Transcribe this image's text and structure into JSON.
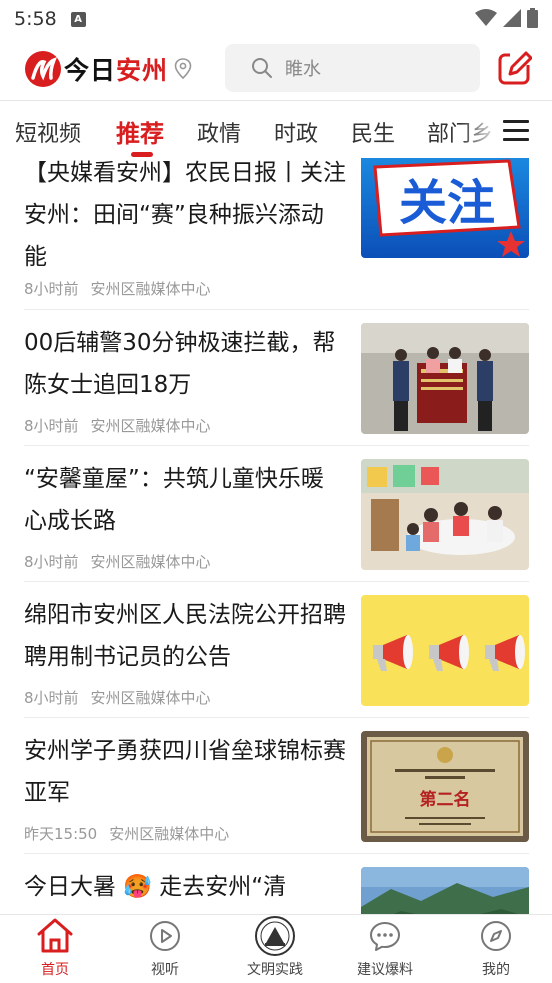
{
  "status_bar": {
    "time": "5:58",
    "notification_icon": "A"
  },
  "header": {
    "logo_text_black": "今日",
    "logo_text_red": "安州",
    "search_placeholder": "睢水",
    "accent_color": "#d81e1e"
  },
  "tabs": [
    {
      "label": "短视频",
      "active": false
    },
    {
      "label": "推荐",
      "active": true
    },
    {
      "label": "政情",
      "active": false
    },
    {
      "label": "时政",
      "active": false
    },
    {
      "label": "民生",
      "active": false
    },
    {
      "label": "部门乡",
      "active": false
    }
  ],
  "news": [
    {
      "title": "【央媒看安州】农民日报丨关注安州：田间“赛”良种振兴添动能",
      "time": "8小时前",
      "source": "安州区融媒体中心",
      "thumb_text": "关注"
    },
    {
      "title": "00后辅警30分钟极速拦截，帮陈女士追回18万",
      "time": "8小时前",
      "source": "安州区融媒体中心"
    },
    {
      "title": "“安馨童屋”：共筑儿童快乐暖心成长路",
      "time": "8小时前",
      "source": "安州区融媒体中心"
    },
    {
      "title": "绵阳市安州区人民法院公开招聘聘用制书记员的公告",
      "time": "8小时前",
      "source": "安州区融媒体中心"
    },
    {
      "title": "安州学子勇获四川省垒球锦标赛亚军",
      "time": "昨天15:50",
      "source": "安州区融媒体中心",
      "thumb_text": "第二名"
    },
    {
      "title": "今日大暑 🥵 走去安州“清",
      "time": "",
      "source": ""
    }
  ],
  "bottom_nav": [
    {
      "label": "首页",
      "icon": "home-icon",
      "active": true
    },
    {
      "label": "视听",
      "icon": "play-icon",
      "active": false
    },
    {
      "label": "文明实践",
      "icon": "emblem-icon",
      "active": false
    },
    {
      "label": "建议爆料",
      "icon": "chat-icon",
      "active": false
    },
    {
      "label": "我的",
      "icon": "compass-icon",
      "active": false
    }
  ]
}
